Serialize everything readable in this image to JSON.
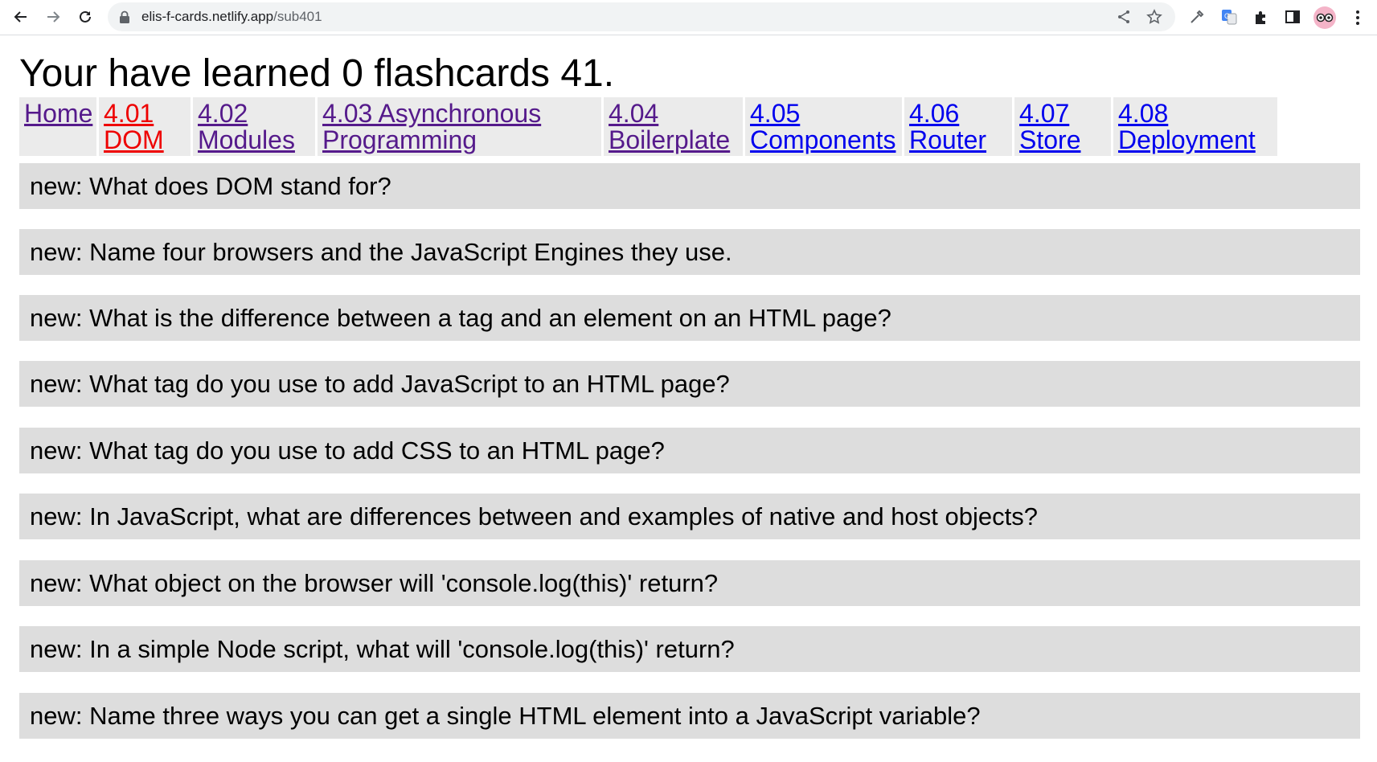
{
  "browser": {
    "url_host": "elis-f-cards.netlify.app",
    "url_path": "/sub401",
    "icons": [
      "back-arrow-icon",
      "forward-arrow-icon",
      "reload-icon",
      "lock-icon",
      "share-icon",
      "star-icon",
      "eyedropper-icon",
      "translate-icon",
      "puzzle-icon",
      "side-panel-icon",
      "avatar",
      "more-menu-icon"
    ]
  },
  "page": {
    "title": "Your have learned 0 flashcards 41."
  },
  "nav": {
    "items": [
      {
        "label": "Home",
        "state": "visited"
      },
      {
        "label": "4.01 DOM",
        "state": "active"
      },
      {
        "label": "4.02 Modules",
        "state": "visited"
      },
      {
        "label": "4.03 Asynchronous Programming",
        "state": "visited"
      },
      {
        "label": "4.04 Boilerplate",
        "state": "visited"
      },
      {
        "label": "4.05 Components",
        "state": "link"
      },
      {
        "label": "4.06 Router",
        "state": "link"
      },
      {
        "label": "4.07 Store",
        "state": "link"
      },
      {
        "label": "4.08 Deployment",
        "state": "link"
      }
    ]
  },
  "cards": [
    "new: What does DOM stand for?",
    "new: Name four browsers and the JavaScript Engines they use.",
    "new: What is the difference between a tag and an element on an HTML page?",
    "new: What tag do you use to add JavaScript to an HTML page?",
    "new: What tag do you use to add CSS to an HTML page?",
    "new: In JavaScript, what are differences between and examples of native and host objects?",
    "new: What object on the browser will 'console.log(this)' return?",
    "new: In a simple Node script, what will 'console.log(this)' return?",
    "new: Name three ways you can get a single HTML element into a JavaScript variable?"
  ],
  "colors": {
    "card_bg": "#dddddd",
    "nav_bg": "#ebebeb",
    "link": "#0000ee",
    "visited": "#551a8b",
    "active": "#ee0000"
  }
}
